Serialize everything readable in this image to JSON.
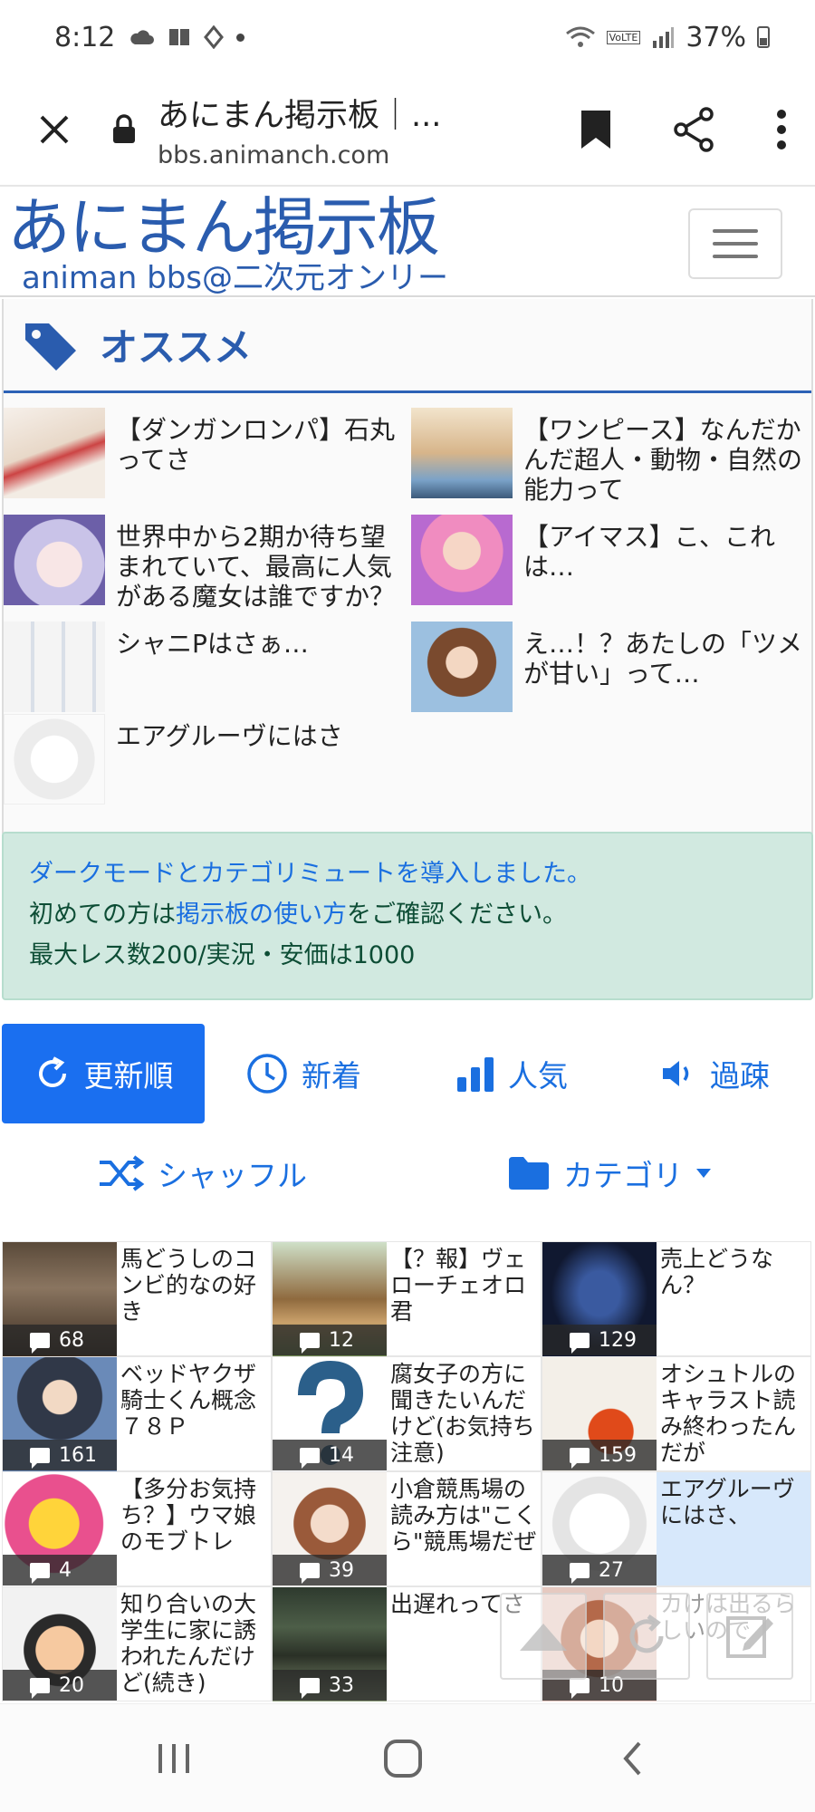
{
  "status_bar": {
    "time": "8:12",
    "battery": "37%",
    "network_badge": "VoLTE"
  },
  "browser": {
    "title": "あにまん掲示板｜...",
    "url": "bbs.animanch.com"
  },
  "site": {
    "logo_main": "あにまん掲示板",
    "logo_sub": "animan bbs@二次元オンリー"
  },
  "recommended": {
    "heading": "オススメ",
    "items": [
      {
        "title": "【ダンガンロンパ】石丸ってさ"
      },
      {
        "title": "【ワンピース】なんだかんだ超人・動物・自然の能力って"
      },
      {
        "title": "世界中から2期か待ち望まれていて、最高に人気がある魔女は誰ですか？"
      },
      {
        "title": "【アイマス】こ、これは…"
      },
      {
        "title": "シャニPはさぁ…"
      },
      {
        "title": "え…！？あたしの「ツメが甘い」って…"
      },
      {
        "title": "エアグルーヴにはさ"
      }
    ]
  },
  "notice": {
    "line1": "ダークモードとカテゴリミュートを導入しました。",
    "line2_prefix": "初めての方は",
    "line2_link": "掲示板の使い方",
    "line2_suffix": "をご確認ください。",
    "line3": "最大レス数200/実況・安価は1000"
  },
  "tabs": [
    {
      "label": "更新順",
      "active": true
    },
    {
      "label": "新着",
      "active": false
    },
    {
      "label": "人気",
      "active": false
    },
    {
      "label": "過疎",
      "active": false
    }
  ],
  "filters": {
    "shuffle": "シャッフル",
    "category": "カテゴリ"
  },
  "threads": [
    {
      "title": "馬どうしのコンビ的なの好き",
      "count": "68"
    },
    {
      "title": "【？報】ヴェローチェオロ君",
      "count": "12"
    },
    {
      "title": "売上どうなん？",
      "count": "129"
    },
    {
      "title": "ベッドヤクザ騎士くん概念７８Ｐ",
      "count": "161"
    },
    {
      "title": "腐女子の方に聞きたいんだけど(お気持ち注意)",
      "count": "14"
    },
    {
      "title": "オシュトルのキャラスト読み終わったんだが",
      "count": "159"
    },
    {
      "title": "【多分お気持ち？】ウマ娘のモブトレ",
      "count": "4"
    },
    {
      "title": "小倉競馬場の読み方は\"こくら\"競馬場だぜ",
      "count": "39"
    },
    {
      "title": "エアグルーヴにはさ、",
      "count": "27"
    },
    {
      "title": "知り合いの大学生に家に誘われたんだけど(続き)",
      "count": "20"
    },
    {
      "title": "出遅れってさ",
      "count": "33"
    },
    {
      "title": "カけは出るらしいので",
      "count": "10"
    }
  ],
  "colors": {
    "accent": "#1a6ff0",
    "logo": "#2a5cae",
    "notice_bg": "#d1e9e0"
  }
}
